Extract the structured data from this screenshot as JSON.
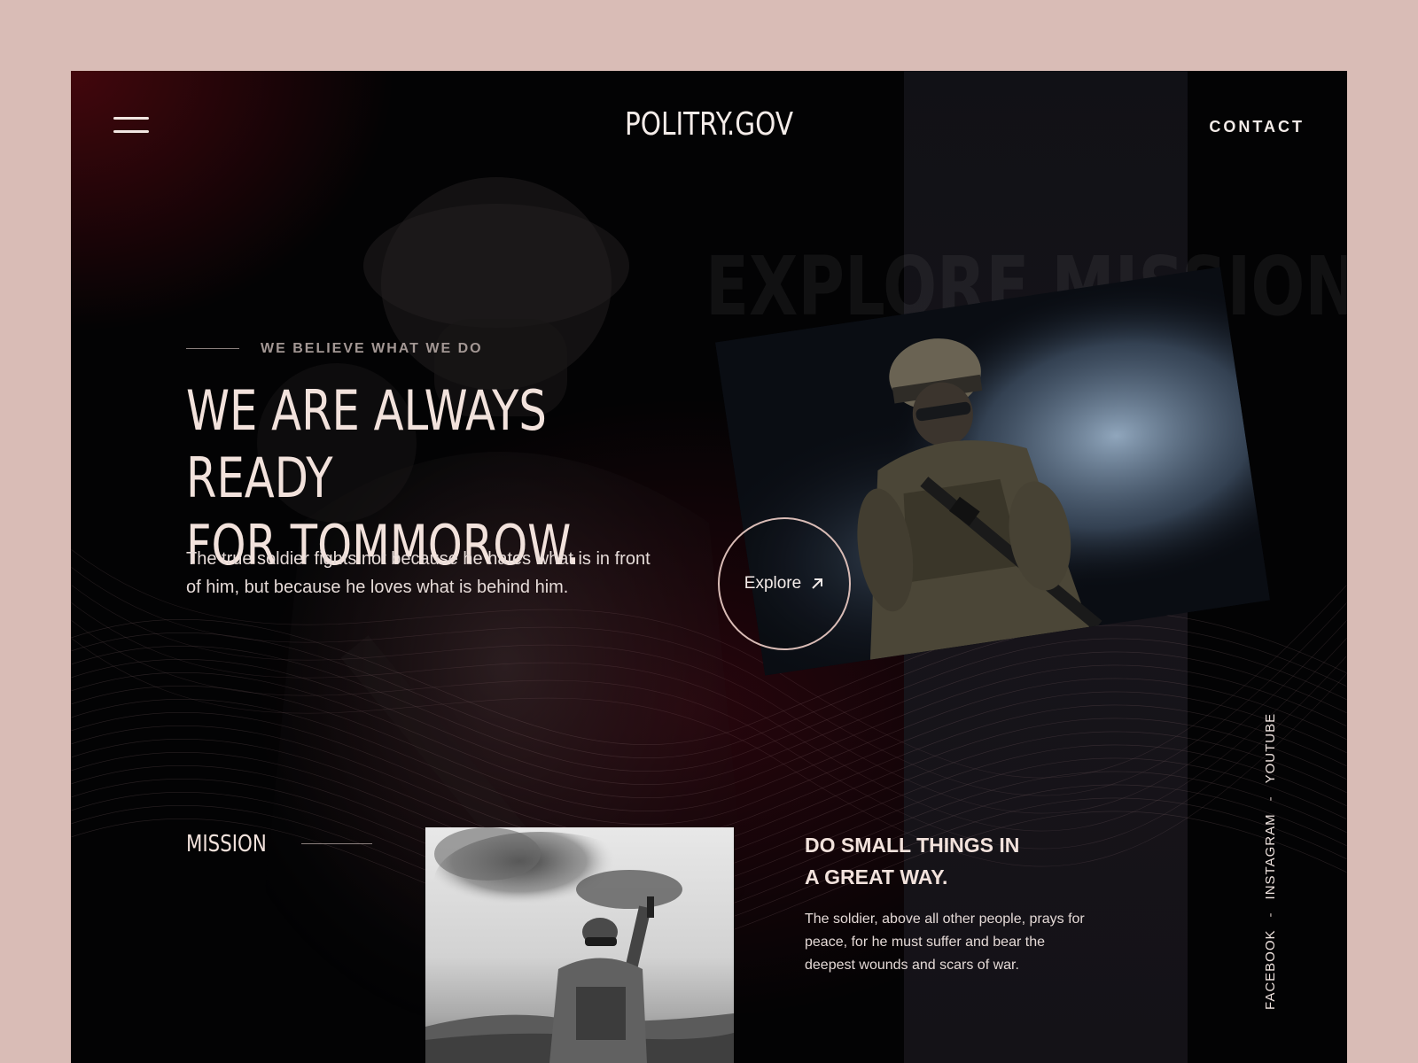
{
  "header": {
    "logo": "POLITRY.GOV",
    "contact_label": "CONTACT"
  },
  "hero": {
    "background_title": "EXPLORE MISSION",
    "eyebrow": "WE BELIEVE WHAT WE DO",
    "headline_line1": "WE ARE ALWAYS READY",
    "headline_line2": "FOR TOMMOROW.",
    "lead": "The true soldier fights not because he hates what is in front of him, but because he loves what is behind him.",
    "explore_label": "Explore"
  },
  "mission": {
    "label": "MISSION",
    "heading_line1": "DO SMALL THINGS IN",
    "heading_line2": "A GREAT WAY.",
    "text": "The soldier, above all other people, prays for peace, for he must suffer and bear the deepest wounds and scars of war."
  },
  "social": {
    "items": [
      "FACEBOOK",
      "INSTAGRAM",
      "YOUTUBE"
    ],
    "separator": "-"
  },
  "icons": {
    "menu": "hamburger-icon",
    "explore": "arrow-up-right-icon"
  },
  "colors": {
    "page_bg": "#d9bcb6",
    "frame_bg": "#030304",
    "accent": "#d9bcb6",
    "text_primary": "#f2e2dc"
  }
}
